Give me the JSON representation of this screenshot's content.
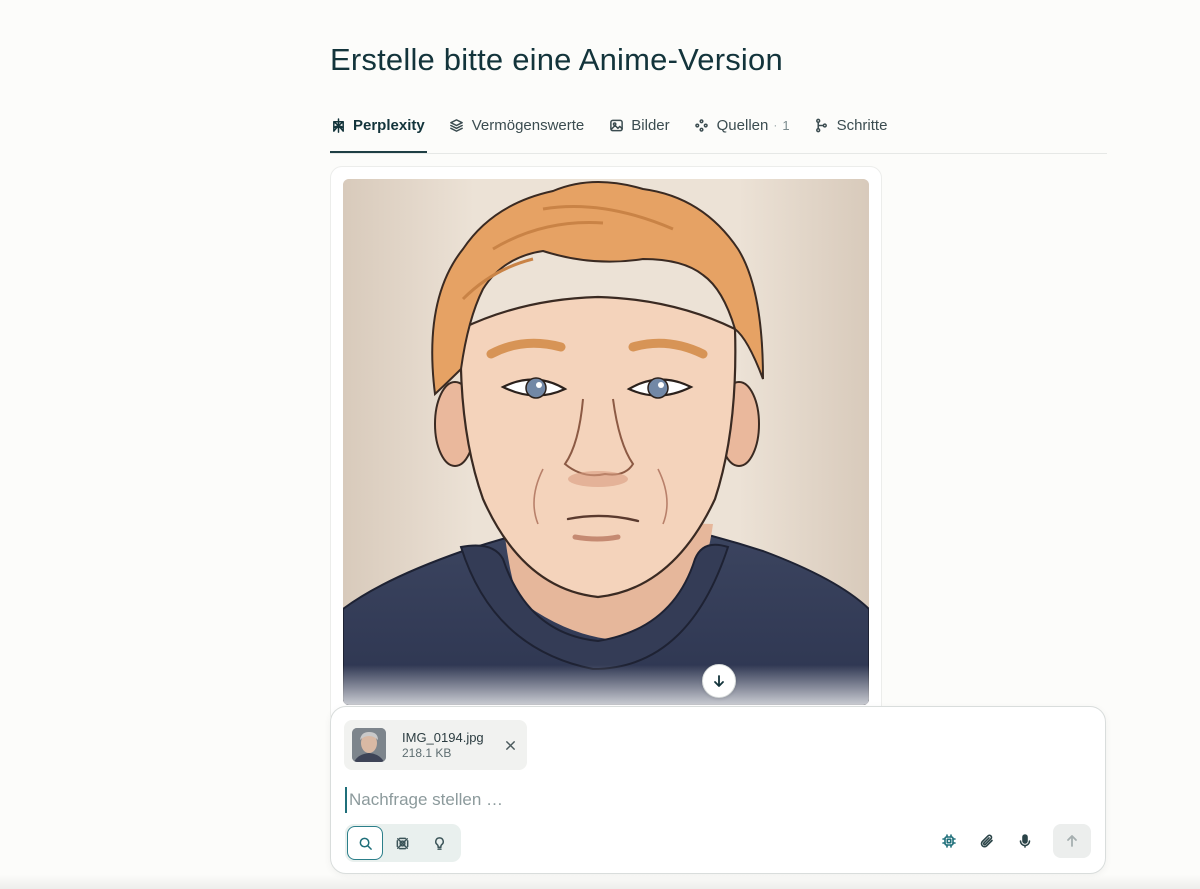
{
  "thread": {
    "title": "Erstelle bitte eine Anime-Version"
  },
  "tabs": [
    {
      "label": "Perplexity",
      "icon": "perplexity-logo-icon",
      "active": true
    },
    {
      "label": "Vermögenswerte",
      "icon": "layers-icon",
      "active": false
    },
    {
      "label": "Bilder",
      "icon": "image-icon",
      "active": false
    },
    {
      "label": "Quellen",
      "icon": "sources-icon",
      "count": "1",
      "separator": "·",
      "active": false
    },
    {
      "label": "Schritte",
      "icon": "steps-icon",
      "active": false
    }
  ],
  "result": {
    "image_icon": "anime-portrait-image",
    "download_icon": "arrow-down-icon"
  },
  "composer": {
    "attachment": {
      "file_name": "IMG_0194.jpg",
      "file_size": "218.1 KB",
      "remove_icon": "close-icon"
    },
    "placeholder": "Nachfrage stellen …",
    "modes": [
      {
        "name": "search",
        "icon": "search-icon",
        "active": true
      },
      {
        "name": "research",
        "icon": "research-icon",
        "active": false
      },
      {
        "name": "labs",
        "icon": "lightbulb-icon",
        "active": false
      }
    ],
    "tools": [
      {
        "name": "model",
        "icon": "chip-icon"
      },
      {
        "name": "attach",
        "icon": "paperclip-icon"
      },
      {
        "name": "voice",
        "icon": "microphone-icon"
      }
    ],
    "send_icon": "arrow-up-icon"
  },
  "colors": {
    "text": "#13343b",
    "accent": "#1f6f7a",
    "background": "#fcfcfa"
  }
}
